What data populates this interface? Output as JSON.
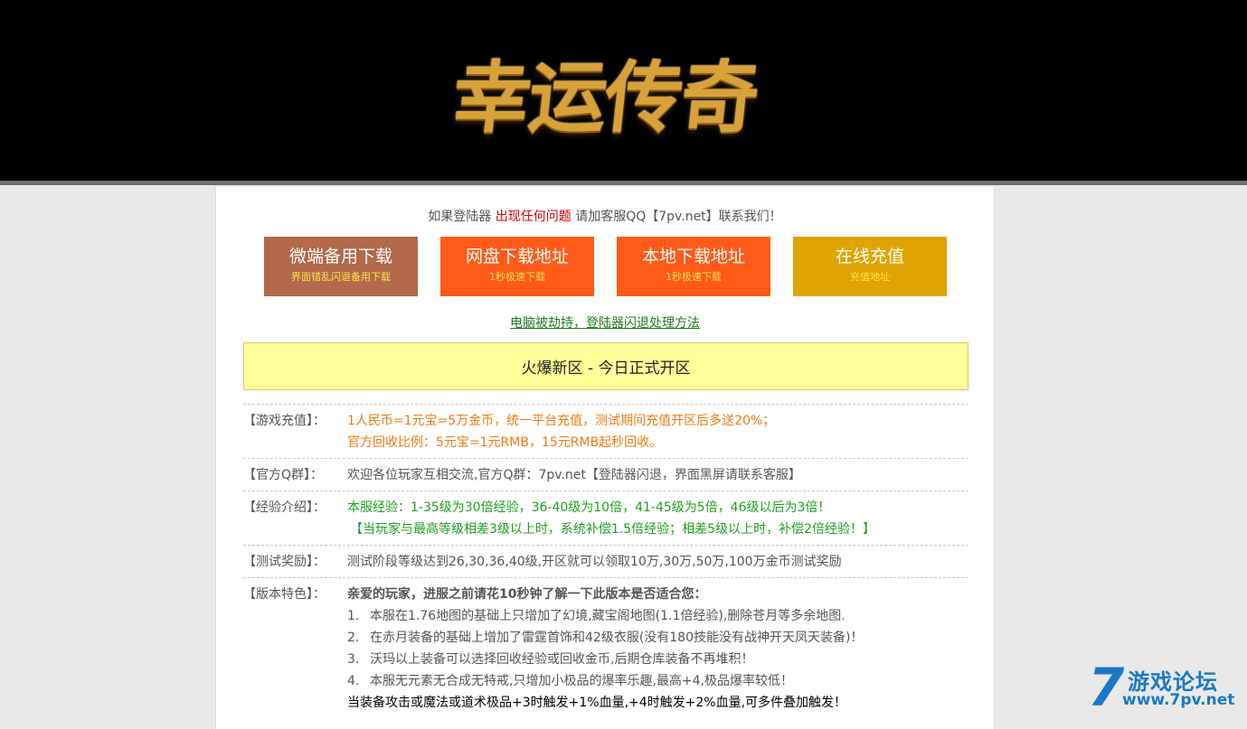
{
  "header": {
    "logo_text": "幸运传奇"
  },
  "notice": {
    "before": "如果登陆器 ",
    "highlight": "出现任何问题",
    "after": " 请加客服QQ【7pv.net】联系我们！"
  },
  "buttons": [
    {
      "label": "微端备用下载",
      "sub": "界面错乱闪退备用下载"
    },
    {
      "label": "网盘下载地址",
      "sub": "1秒极速下载"
    },
    {
      "label": "本地下载地址",
      "sub": "1秒极速下载"
    },
    {
      "label": "在线充值",
      "sub": "充值地址"
    }
  ],
  "fix_link": "电脑被劫持，登陆器闪退处理方法",
  "banner": "火爆新区 - 今日正式开区",
  "info": {
    "recharge": {
      "label": "【游戏充值】：",
      "line1": "1人民币=1元宝=5万金币，统一平台充值，测试期间充值开区后多送20%；",
      "line2": "官方回收比例：5元宝=1元RMB，15元RMB起秒回收。"
    },
    "group": {
      "label": "【官方Q群】：",
      "text": "欢迎各位玩家互相交流,官方Q群：7pv.net【登陆器闪退，界面黑屏请联系客服】"
    },
    "exp": {
      "label": "【经验介绍】：",
      "line1": "本服经验：1-35级为30倍经验，36-40级为10倍，41-45级为5倍，46级以后为3倍！",
      "line2": "【当玩家与最高等级相差3级以上时，系统补偿1.5倍经验；相差5级以上时，补偿2倍经验！】"
    },
    "test": {
      "label": "【测试奖励】：",
      "text": "测试阶段等级达到26,30,36,40级,开区就可以领取10万,30万,50万,100万金币测试奖励"
    },
    "features": {
      "label": "【版本特色】：",
      "intro": "亲爱的玩家，进服之前请花10秒钟了解一下此版本是否适合您：",
      "items": [
        {
          "num": "1.",
          "text": "本服在1.76地图的基础上只增加了幻境,藏宝阁地图(1.1倍经验),删除苍月等多余地图."
        },
        {
          "num": "2.",
          "text": "在赤月装备的基础上增加了雷霆首饰和42级衣服(没有180技能没有战神开天凤天装备)！"
        },
        {
          "num": "3.",
          "text": "沃玛以上装备可以选择回收经验或回收金币,后期仓库装备不再堆积！"
        },
        {
          "num": "4.",
          "text": "本服无元素无合成无特戒,只增加小极品的爆率乐趣,最高+4,极品爆率较低！"
        }
      ],
      "extra": "当装备攻击或魔法或道术极品+3时触发+1%血量,+4时触发+2%血量,可多件叠加触发！"
    }
  },
  "watermark": {
    "digit": "7",
    "name": "游戏论坛",
    "url": "www.7pv.net"
  }
}
